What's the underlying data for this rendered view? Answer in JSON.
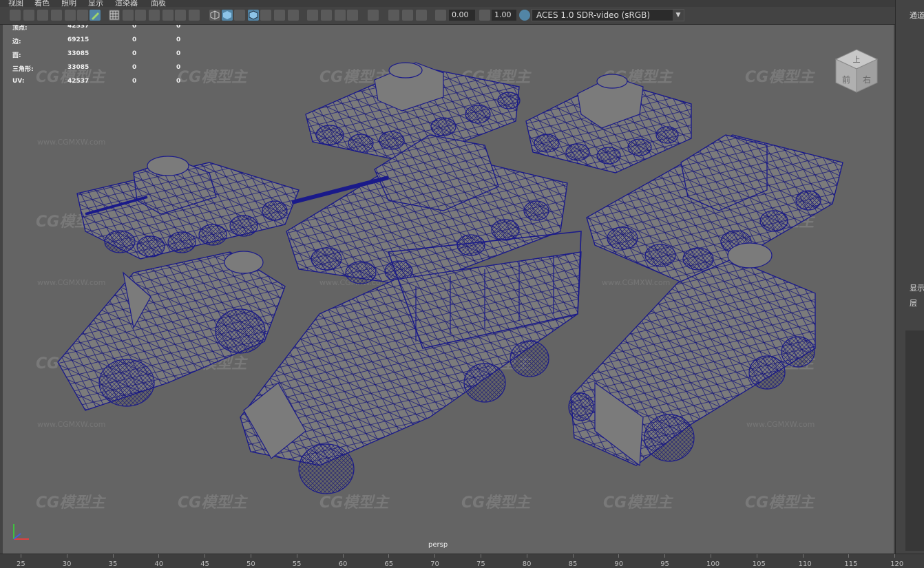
{
  "menu": [
    "视图",
    "着色",
    "照明",
    "显示",
    "渲染器",
    "面板"
  ],
  "toolbar": {
    "exposure": "0.00",
    "gamma": "1.00",
    "color_space": "ACES 1.0 SDR-video (sRGB)"
  },
  "hud": {
    "rows": [
      {
        "label": "顶点:",
        "v1": "42537",
        "v2": "0",
        "v3": "0"
      },
      {
        "label": "边:",
        "v1": "69215",
        "v2": "0",
        "v3": "0"
      },
      {
        "label": "面:",
        "v1": "33085",
        "v2": "0",
        "v3": "0"
      },
      {
        "label": "三角形:",
        "v1": "33085",
        "v2": "0",
        "v3": "0"
      },
      {
        "label": "UV:",
        "v1": "42537",
        "v2": "0",
        "v3": "0"
      }
    ]
  },
  "viewport": {
    "camera_label": "persp",
    "viewcube_faces": [
      "上",
      "前",
      "右"
    ],
    "watermark_text": "CG模型主",
    "watermark_url": "www.CGMXW.com"
  },
  "right_panel": {
    "top_label": "通道",
    "display_label": "显示",
    "layer_label": "层"
  },
  "timeline": {
    "ticks": [
      "25",
      "30",
      "35",
      "40",
      "45",
      "50",
      "55",
      "60",
      "65",
      "70",
      "75",
      "80",
      "85",
      "90",
      "95",
      "100",
      "105",
      "110",
      "115",
      "120"
    ]
  },
  "colors": {
    "viewport_bg": "#646464",
    "wireframe": "#14147a",
    "highlight": "#5285a6"
  }
}
